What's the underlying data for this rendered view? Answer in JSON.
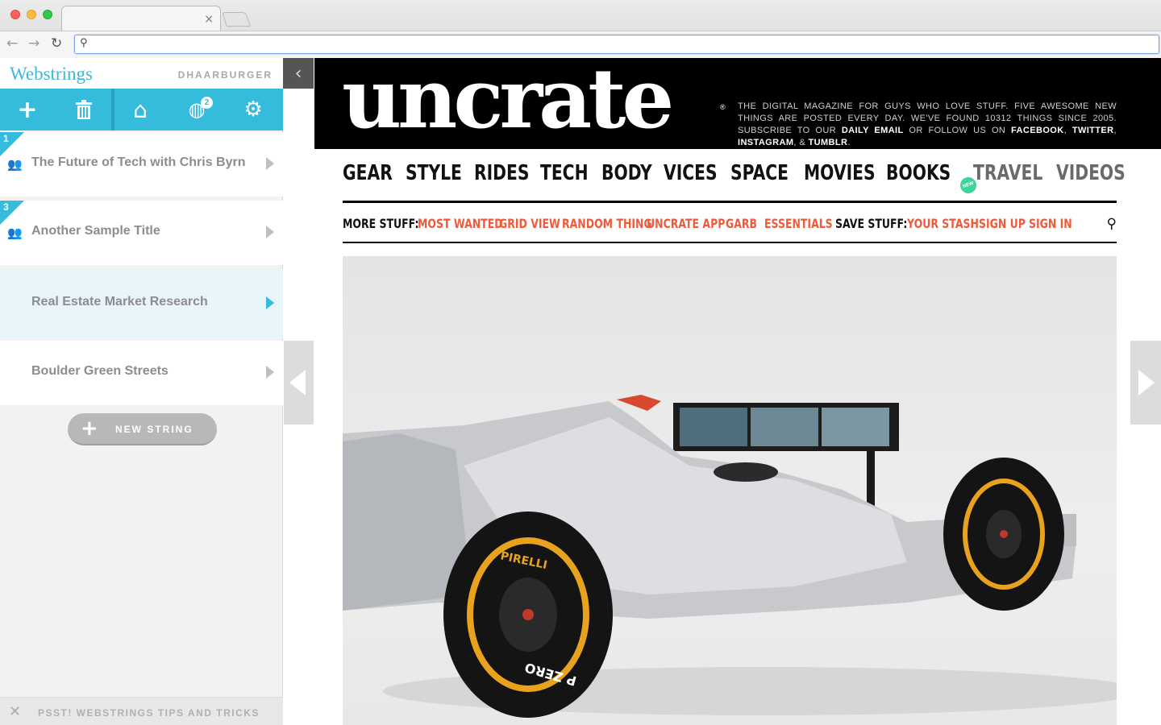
{
  "browser": {
    "tab_close": "×",
    "address": ""
  },
  "sidebar": {
    "brand": "Webstrings",
    "username": "DHAARBURGER",
    "toolbar": {
      "globe_badge": "2"
    },
    "strings": [
      {
        "number": "1",
        "title": "The Future of Tech with Chris Byrn",
        "shared": true
      },
      {
        "number": "3",
        "title": "Another Sample Title",
        "shared": true
      },
      {
        "number": "",
        "title": "Real Estate Market Research",
        "shared": false
      },
      {
        "number": "",
        "title": "Boulder Green Streets",
        "shared": false
      }
    ],
    "new_string_label": "NEW STRING",
    "tips_label": "PSST! WEBSTRINGS TIPS AND TRICKS"
  },
  "site": {
    "logo": "uncrate",
    "reg_mark": "®",
    "tagline": {
      "line1": "THE DIGITAL MAGAZINE FOR GUYS WHO LOVE STUFF. FIVE AWESOME NEW THINGS ARE POSTED EVERY DAY. WE'VE FOUND 10312 THINGS SINCE 2005. SUBSCRIBE TO OUR",
      "daily_email": "DAILY EMAIL",
      "or_follow": "OR FOLLOW US ON",
      "facebook": "FACEBOOK",
      "twitter": "TWITTER",
      "instagram": "INSTAGRAM",
      "amp": "&",
      "tumblr": "TUMBLR"
    },
    "main_nav": [
      "GEAR",
      "STYLE",
      "RIDES",
      "TECH",
      "BODY",
      "VICES",
      "SPACE",
      "MOVIES",
      "BOOKS",
      "TRAVEL",
      "VIDEOS"
    ],
    "new_badge": "NEW",
    "more_stuff_label": "MORE STUFF:",
    "more_stuff": [
      "MOST WANTED",
      "GRID VIEW",
      "RANDOM THING",
      "UNCRATE APP",
      "GARB",
      "ESSENTIALS"
    ],
    "save_stuff_label": "SAVE STUFF:",
    "save_stuff": [
      "YOUR STASH",
      "SIGN UP",
      "SIGN IN"
    ],
    "tire_brand": "PIRELLI",
    "tire_model": "P ZERO"
  },
  "colors": {
    "accent": "#35bbdb",
    "link_orange": "#ef5a3c",
    "new_badge": "#3ed39b"
  }
}
